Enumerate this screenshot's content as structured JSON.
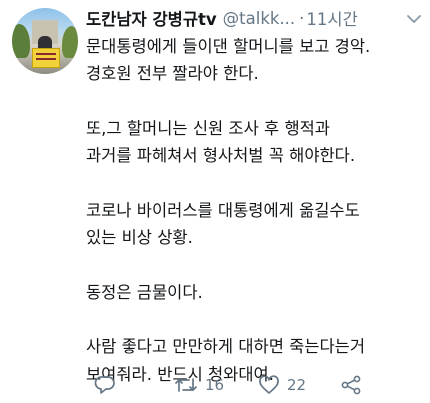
{
  "tweet": {
    "author_name": "도칸남자 강병규tv",
    "handle": "@talkk...",
    "separator": "·",
    "time": "11시간",
    "lines": [
      "문대통령에게 들이댄 할머니를 보고 경악.",
      "경호원 전부 짤라야 한다.",
      "",
      "또,그 할머니는 신원 조사 후 행적과",
      "과거를 파헤쳐서 형사처벌 꼭 해야한다.",
      "",
      "코로나 바이러스를 대통령에게 옮길수도",
      "있는 비상 상황.",
      "",
      "동정은 금물이다.",
      "",
      "사람 좋다고 만만하게 대하면 죽는다는거",
      "보여줘라. 반드시 청와대여."
    ],
    "retweet_count": "16",
    "like_count": "22"
  },
  "icons": {
    "avatar": "profile-photo",
    "caret": "chevron-down-icon",
    "reply": "reply-icon",
    "retweet": "retweet-icon",
    "like": "heart-icon",
    "share": "share-icon"
  },
  "colors": {
    "text": "#14171a",
    "secondary": "#657786",
    "background": "#ffffff"
  }
}
